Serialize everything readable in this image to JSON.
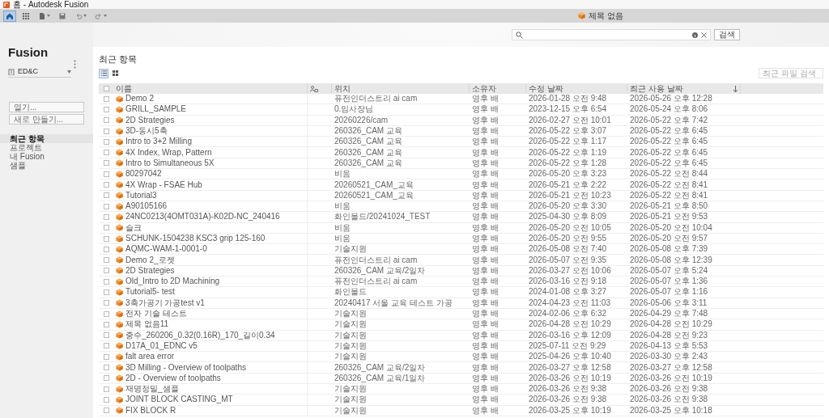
{
  "window": {
    "title": "홈 - Autodesk Fusion"
  },
  "toolbar": {
    "tools": [
      {
        "kind": "home",
        "selected": true
      },
      {
        "kind": "apps",
        "selected": false
      },
      {
        "kind": "file",
        "selected": false
      },
      {
        "kind": "save",
        "selected": false
      },
      {
        "kind": "undo",
        "selected": false
      },
      {
        "kind": "redo",
        "selected": false
      }
    ],
    "document_tab": "제목 없음"
  },
  "search": {
    "button": "검색"
  },
  "sidebar": {
    "app_name": "Fusion",
    "hub": "ED&C",
    "buttons": [
      "열기...",
      "새로 만들기..."
    ],
    "items": [
      {
        "label": "최근 항목",
        "selected": true
      },
      {
        "label": "프로젝트",
        "selected": false
      },
      {
        "label": "내 Fusion",
        "selected": false
      },
      {
        "label": "샘플",
        "selected": false
      }
    ]
  },
  "main": {
    "heading": "최근 항목",
    "views": [
      {
        "kind": "list",
        "selected": true
      },
      {
        "kind": "grid",
        "selected": false
      }
    ],
    "filter": {
      "placeholder": "최근 파일 검색"
    }
  },
  "table": {
    "select_all_checked": false,
    "columns": [
      {
        "kind": "text",
        "label": "이름",
        "sorted": false
      },
      {
        "kind": "shared",
        "sorted": false
      },
      {
        "kind": "text",
        "label": "위치",
        "sorted": false
      },
      {
        "kind": "text",
        "label": "소유자",
        "sorted": false
      },
      {
        "kind": "text",
        "label": "수정 날짜",
        "sorted": false
      },
      {
        "kind": "text",
        "label": "최근 사용 날짜",
        "sorted": true
      }
    ],
    "rows": [
      {
        "checked": false,
        "name": "Demo 2",
        "location": "퓨전인더스트리 ai cam",
        "owner": "영후 배",
        "modified": "2026-01-28 오전 9:48",
        "last_opened": "2026-05-26 오후 12:28"
      },
      {
        "checked": false,
        "name": "GRILL_SAMPLE",
        "location": "0.임사장님",
        "owner": "영후 배",
        "modified": "2023-12-15 오후 6:54",
        "last_opened": "2026-05-24 오후 8:06"
      },
      {
        "checked": false,
        "name": "2D Strategies",
        "location": "20260226/cam",
        "owner": "영후 배",
        "modified": "2026-02-27 오전 10:01",
        "last_opened": "2026-05-22 오후 7:42"
      },
      {
        "checked": false,
        "name": "3D-동시5축",
        "location": "260326_CAM 교육",
        "owner": "영후 배",
        "modified": "2026-05-22 오후 3:07",
        "last_opened": "2026-05-22 오후 6:45"
      },
      {
        "checked": false,
        "name": "Intro to 3+2 Milling",
        "location": "260326_CAM 교육",
        "owner": "영후 배",
        "modified": "2026-05-22 오후 1:17",
        "last_opened": "2026-05-22 오후 6:45"
      },
      {
        "checked": false,
        "name": "4X Index, Wrap, Pattern",
        "location": "260326_CAM 교육",
        "owner": "영후 배",
        "modified": "2026-05-22 오후 1:19",
        "last_opened": "2026-05-22 오후 6:45"
      },
      {
        "checked": false,
        "name": "Intro to Simultaneous 5X",
        "location": "260326_CAM 교육",
        "owner": "영후 배",
        "modified": "2026-05-22 오후 1:28",
        "last_opened": "2026-05-22 오후 6:45"
      },
      {
        "checked": false,
        "name": "80297042",
        "location": "비움",
        "owner": "영후 배",
        "modified": "2026-05-20 오후 3:23",
        "last_opened": "2026-05-22 오전 8:44"
      },
      {
        "checked": false,
        "name": "4X Wrap - FSAE Hub",
        "location": "20260521_CAM_교육",
        "owner": "영후 배",
        "modified": "2026-05-21 오후 2:22",
        "last_opened": "2026-05-22 오전 8:41"
      },
      {
        "checked": false,
        "name": "Tutorial3",
        "location": "20260521_CAM_교육",
        "owner": "영후 배",
        "modified": "2026-05-21 오전 10:23",
        "last_opened": "2026-05-22 오전 8:41"
      },
      {
        "checked": false,
        "name": "A90105166",
        "location": "비움",
        "owner": "영후 배",
        "modified": "2026-05-20 오후 3:30",
        "last_opened": "2026-05-21 오후 8:50"
      },
      {
        "checked": false,
        "name": "24NC0213(4OMT031A)-K02D-NC_240416",
        "location": "화인몰드/20241024_TEST",
        "owner": "영후 배",
        "modified": "2025-04-30 오후 8:09",
        "last_opened": "2026-05-21 오전 9:53"
      },
      {
        "checked": false,
        "name": "슬크",
        "location": "비움",
        "owner": "영후 배",
        "modified": "2026-05-20 오전 10:05",
        "last_opened": "2026-05-20 오전 10:04"
      },
      {
        "checked": false,
        "name": "SCHUNK-1504238 KSC3 grip 125-160",
        "location": "비움",
        "owner": "영후 배",
        "modified": "2026-05-20 오전 9:55",
        "last_opened": "2026-05-20 오전 9:57"
      },
      {
        "checked": false,
        "name": "AQMC-WAM-1-0001-0",
        "location": "기술지원",
        "owner": "영후 배",
        "modified": "2026-05-08 오전 7:40",
        "last_opened": "2026-05-08 오후 7:39"
      },
      {
        "checked": false,
        "name": "Demo 2_로젯",
        "location": "퓨전인더스트리 ai cam",
        "owner": "영후 배",
        "modified": "2026-05-07 오전 9:35",
        "last_opened": "2026-05-08 오후 12:39"
      },
      {
        "checked": false,
        "name": "2D Strategies",
        "location": "260326_CAM 교육/2일차",
        "owner": "영후 배",
        "modified": "2026-03-27 오전 10:06",
        "last_opened": "2026-05-07 오후 5:24"
      },
      {
        "checked": false,
        "name": "Old_Intro to 2D Machining",
        "location": "퓨전인더스트리 ai cam",
        "owner": "영후 배",
        "modified": "2026-03-16 오전 9:18",
        "last_opened": "2026-05-07 오후 1:36"
      },
      {
        "checked": false,
        "name": "Tutorial5- test",
        "location": "화인몰드",
        "owner": "영후 배",
        "modified": "2024-01-08 오후 3:27",
        "last_opened": "2026-05-07 오후 1:16"
      },
      {
        "checked": false,
        "name": "3축가공기 가공test v1",
        "location": "20240417 서울 교육 테스트 가공",
        "owner": "영후 배",
        "modified": "2024-04-23 오전 11:03",
        "last_opened": "2026-05-06 오후 3:11"
      },
      {
        "checked": false,
        "name": "전자 기술 테스트",
        "location": "기술지원",
        "owner": "영후 배",
        "modified": "2024-02-06 오후 6:32",
        "last_opened": "2026-04-29 오후 7:48"
      },
      {
        "checked": false,
        "name": "제목 없음11",
        "location": "기술지원",
        "owner": "영후 배",
        "modified": "2026-04-28 오전 10:29",
        "last_opened": "2026-04-28 오전 10:29"
      },
      {
        "checked": false,
        "name": "중수_260206_0.32(0.16R)_170_길이0.34",
        "location": "기술지원",
        "owner": "영후 배",
        "modified": "2026-03-16 오후 12:09",
        "last_opened": "2026-04-28 오전 9:23"
      },
      {
        "checked": false,
        "name": "D17A_01_EDNC v5",
        "location": "기술지원",
        "owner": "영후 배",
        "modified": "2025-07-11 오전 9:29",
        "last_opened": "2026-04-13 오후 5:53"
      },
      {
        "checked": false,
        "name": "falt area error",
        "location": "기술지원",
        "owner": "영후 배",
        "modified": "2025-04-26 오후 10:40",
        "last_opened": "2026-03-30 오후 2:43"
      },
      {
        "checked": false,
        "name": "3D Milling - Overview of toolpaths",
        "location": "260326_CAM 교육/2일차",
        "owner": "영후 배",
        "modified": "2026-03-27 오후 12:58",
        "last_opened": "2026-03-27 오후 12:58"
      },
      {
        "checked": false,
        "name": "2D - Overview of toolpaths",
        "location": "260326_CAM 교육/1일차",
        "owner": "영후 배",
        "modified": "2026-03-26 오전 10:19",
        "last_opened": "2026-03-26 오전 10:19"
      },
      {
        "checked": false,
        "name": "재명정밀_샘플",
        "location": "기술지원",
        "owner": "영후 배",
        "modified": "2026-03-26 오전 9:38",
        "last_opened": "2026-03-26 오전 9:38"
      },
      {
        "checked": false,
        "name": "JOINT BLOCK CASTING_MT",
        "location": "기술지원",
        "owner": "영후 배",
        "modified": "2026-03-26 오전 9:38",
        "last_opened": "2026-03-26 오전 9:38"
      },
      {
        "checked": false,
        "name": "FIX BLOCK R",
        "location": "기술지원",
        "owner": "영후 배",
        "modified": "2026-03-25 오후 10:19",
        "last_opened": "2026-03-25 오후 10:18"
      }
    ]
  }
}
